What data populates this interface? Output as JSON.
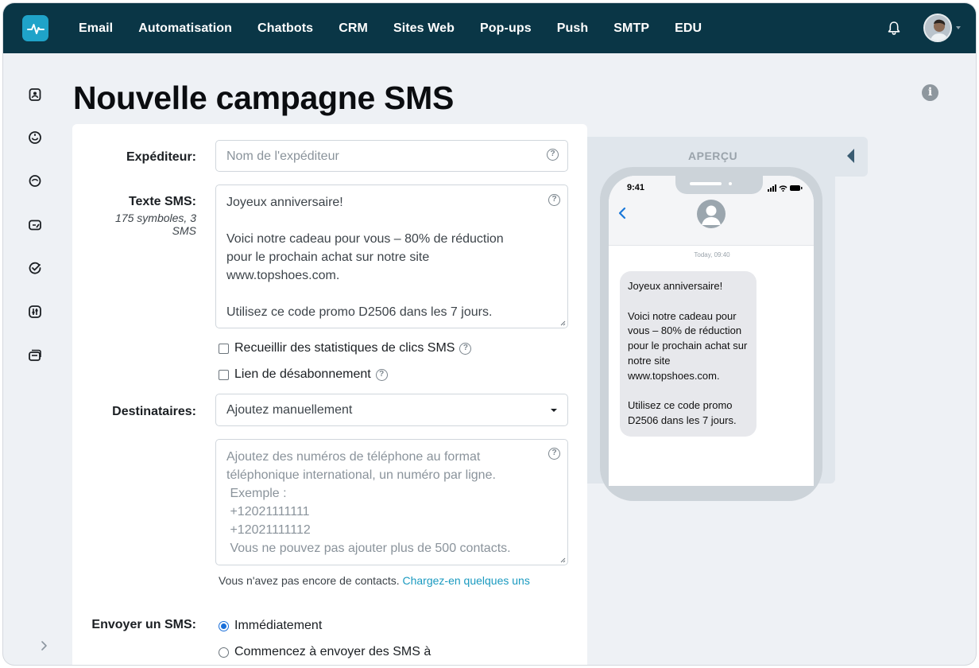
{
  "nav": {
    "items": [
      "Email",
      "Automatisation",
      "Chatbots",
      "CRM",
      "Sites Web",
      "Pop-ups",
      "Push",
      "SMTP",
      "EDU"
    ]
  },
  "page": {
    "title": "Nouvelle campagne SMS"
  },
  "form": {
    "sender_label": "Expéditeur:",
    "sender_placeholder": "Nom de l'expéditeur",
    "text_label": "Texte SMS:",
    "text_meta": "175 symboles, 3 SMS",
    "text_value": "Joyeux anniversaire!\n\nVoici notre cadeau pour vous – 80% de réduction\npour le prochain achat sur notre site\nwww.topshoes.com.\n\nUtilisez ce code promo D2506 dans les 7 jours.",
    "checkbox_clicks": "Recueillir des statistiques de clics SMS",
    "checkbox_unsub": "Lien de désabonnement",
    "recipients_label": "Destinataires:",
    "recipients_select": "Ajoutez manuellement",
    "phones_placeholder": "Ajoutez des numéros de téléphone au format\ntéléphonique international, un numéro par ligne.\n Exemple :\n +12021111111\n +12021111112\n Vous ne pouvez pas ajouter plus de 500 contacts.",
    "no_contacts_note": "Vous n'avez pas encore de contacts.",
    "upload_link": "Chargez-en quelques uns",
    "send_label": "Envoyer un SMS:",
    "send_option_now": "Immédiatement",
    "send_option_later": "Commencez à envoyer des SMS à",
    "send_selected": "Immédiatement"
  },
  "preview": {
    "title": "APERÇU",
    "phone_time": "9:41",
    "message_time": "Today, 09:40",
    "message": "Joyeux anniversaire!\n\nVoici notre cadeau pour vous – 80% de réduction pour le prochain achat sur notre site www.topshoes.com.\n\nUtilisez ce code promo D2506 dans les 7 jours."
  },
  "colors": {
    "nav_bg": "#0a3646",
    "brand": "#1fa3c9",
    "link": "#1a9ac0",
    "radio_on": "#1a6fd9"
  },
  "icons": {
    "logo": "pulse-logo-icon",
    "notifications": "bell-icon",
    "info": "info-icon",
    "help": "question-circle-icon"
  }
}
